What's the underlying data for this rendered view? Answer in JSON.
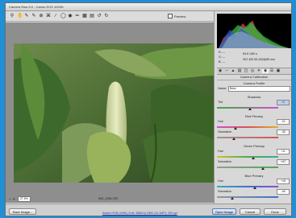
{
  "window": {
    "title": "Camera Raw 5.0  -  Canon EOS 1000D"
  },
  "toolbar": {
    "tools": [
      "zoom-tool",
      "hand-tool",
      "white-balance-tool",
      "color-sampler-tool",
      "targeted-adjustment-tool",
      "crop-tool",
      "straighten-tool",
      "spot-removal-tool",
      "red-eye-tool",
      "adjustment-brush",
      "graduated-filter",
      "preferences",
      "rotate-left",
      "rotate-right"
    ],
    "preview_label": "Preview"
  },
  "status": {
    "zoom": "27.6%",
    "filename": "IMG_0185.CR2"
  },
  "readout": {
    "r": "R: ---",
    "g": "G: ---",
    "b": "B: ---",
    "exposure": "f/5.6  1/80 s",
    "iso": "ISO 400  55-200@85 mm"
  },
  "panel": {
    "section_title": "Camera Calibration",
    "profile_label": "Camera Profile",
    "name_label": "Name:",
    "name_value": "Beta",
    "shadows": {
      "title": "Shadows",
      "tint_label": "Tint",
      "tint_value": "+1"
    },
    "red": {
      "title": "Red Primary",
      "hue_label": "Hue",
      "hue_value": "-22",
      "sat_label": "Saturation",
      "sat_value": "-38"
    },
    "green": {
      "title": "Green Primary",
      "hue_label": "Hue",
      "hue_value": "+11",
      "sat_label": "Saturation",
      "sat_value": "+47"
    },
    "blue": {
      "title": "Blue Primary",
      "hue_label": "Hue",
      "hue_value": "+18",
      "sat_label": "Saturation",
      "sat_value": "-48"
    }
  },
  "buttons": {
    "save": "Save Image...",
    "open": "Open Image",
    "cancel": "Cancel",
    "done": "Done"
  },
  "workflow_link": "Adobe RGB (1998); 8 bit; 3888 by 2592 (10.1MP); 300 ppi",
  "colors": {
    "accent": "#1f8fd6",
    "red_track": "#d9534f",
    "green_track": "#4fa84f",
    "blue_track": "#3d6fd1"
  }
}
